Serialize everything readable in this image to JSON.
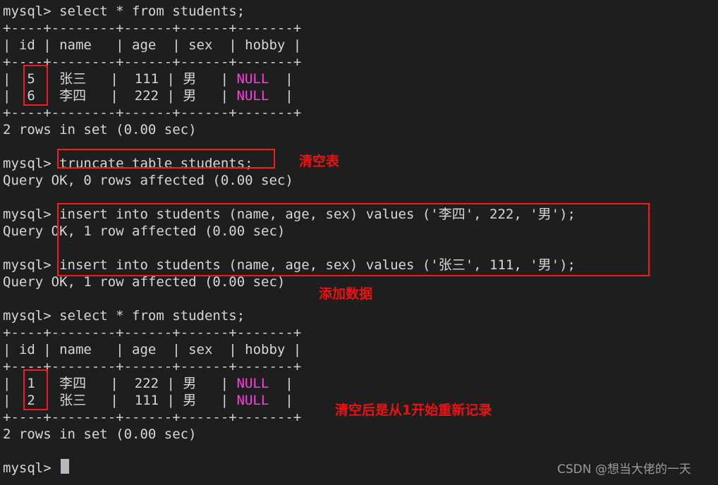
{
  "terminal": {
    "background": "#1e1e1e",
    "foreground": "#d6d6d6",
    "null_color": "#ff3ce8",
    "annotation_color": "#ee1111",
    "prompt": "mysql>"
  },
  "lines": [
    {
      "id": "l1",
      "text": "mysql> select * from students;"
    },
    {
      "id": "l2",
      "text": "+----+--------+------+------+-------+"
    },
    {
      "id": "l3",
      "text": "| id | name   | age  | sex  | hobby |"
    },
    {
      "id": "l4",
      "text": "+----+--------+------+------+-------+"
    },
    {
      "id": "l5",
      "pre": "|  5 | 张三   |  111 | 男   | ",
      "null": "NULL",
      "post": "  |"
    },
    {
      "id": "l6",
      "pre": "|  6 | 李四   |  222 | 男   | ",
      "null": "NULL",
      "post": "  |"
    },
    {
      "id": "l7",
      "text": "+----+--------+------+------+-------+"
    },
    {
      "id": "l8",
      "text": "2 rows in set (0.00 sec)"
    },
    {
      "id": "l9",
      "text": ""
    },
    {
      "id": "l10",
      "text": "mysql> truncate table students;"
    },
    {
      "id": "l11",
      "text": "Query OK, 0 rows affected (0.00 sec)"
    },
    {
      "id": "l12",
      "text": ""
    },
    {
      "id": "l13",
      "text": "mysql> insert into students (name, age, sex) values ('李四', 222, '男');"
    },
    {
      "id": "l14",
      "text": "Query OK, 1 row affected (0.00 sec)"
    },
    {
      "id": "l15",
      "text": ""
    },
    {
      "id": "l16",
      "text": "mysql> insert into students (name, age, sex) values ('张三', 111, '男');"
    },
    {
      "id": "l17",
      "text": "Query OK, 1 row affected (0.00 sec)"
    },
    {
      "id": "l18",
      "text": ""
    },
    {
      "id": "l19",
      "text": "mysql> select * from students;"
    },
    {
      "id": "l20",
      "text": "+----+--------+------+------+-------+"
    },
    {
      "id": "l21",
      "text": "| id | name   | age  | sex  | hobby |"
    },
    {
      "id": "l22",
      "text": "+----+--------+------+------+-------+"
    },
    {
      "id": "l23",
      "pre": "|  1 | 李四   |  222 | 男   | ",
      "null": "NULL",
      "post": "  |"
    },
    {
      "id": "l24",
      "pre": "|  2 | 张三   |  111 | 男   | ",
      "null": "NULL",
      "post": "  |"
    },
    {
      "id": "l25",
      "text": "+----+--------+------+------+-------+"
    },
    {
      "id": "l26",
      "text": "2 rows in set (0.00 sec)"
    },
    {
      "id": "l27",
      "text": ""
    },
    {
      "id": "l28",
      "text": "mysql>"
    }
  ],
  "tables": [
    {
      "name": "students-before-truncate",
      "columns": [
        "id",
        "name",
        "age",
        "sex",
        "hobby"
      ],
      "rows": [
        [
          "5",
          "张三",
          "111",
          "男",
          "NULL"
        ],
        [
          "6",
          "李四",
          "222",
          "男",
          "NULL"
        ]
      ],
      "result_text": "2 rows in set (0.00 sec)"
    },
    {
      "name": "students-after-truncate",
      "columns": [
        "id",
        "name",
        "age",
        "sex",
        "hobby"
      ],
      "rows": [
        [
          "1",
          "李四",
          "222",
          "男",
          "NULL"
        ],
        [
          "2",
          "张三",
          "111",
          "男",
          "NULL"
        ]
      ],
      "result_text": "2 rows in set (0.00 sec)"
    }
  ],
  "annotations": [
    {
      "name": "id-highlight-before",
      "label": ""
    },
    {
      "name": "truncate-command-highlight",
      "label": ""
    },
    {
      "name": "truncate-note",
      "label": "清空表"
    },
    {
      "name": "insert-block-highlight",
      "label": ""
    },
    {
      "name": "insert-note",
      "label": "添加数据"
    },
    {
      "name": "id-highlight-after",
      "label": ""
    },
    {
      "name": "reset-note",
      "label": "清空后是从1开始重新记录"
    }
  ],
  "watermark": "CSDN @想当大佬的一天"
}
